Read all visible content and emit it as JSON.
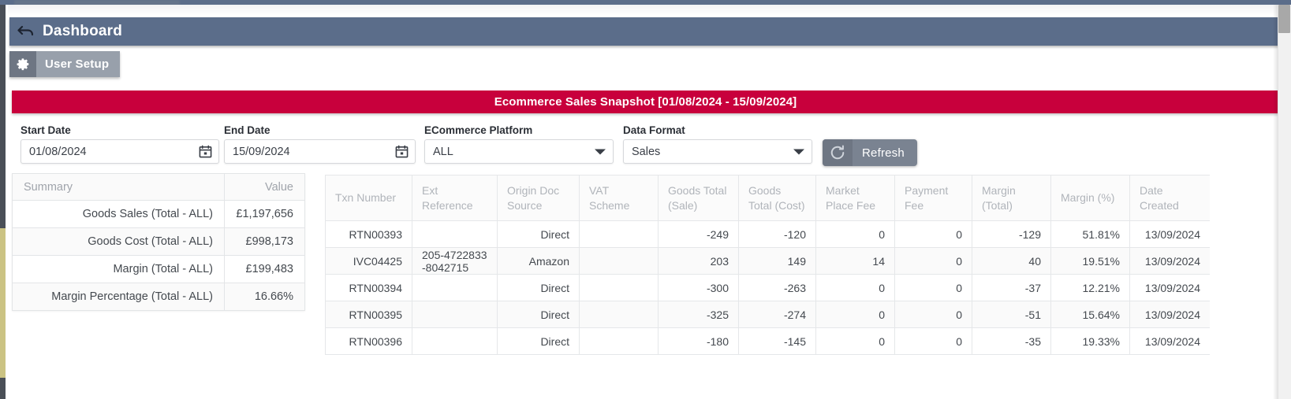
{
  "header": {
    "back_icon": "undo-arrow-icon",
    "title": "Dashboard"
  },
  "user_setup": {
    "icon": "gear-icon",
    "label": "User Setup"
  },
  "snapshot": {
    "title": "Ecommerce Sales Snapshot [01/08/2024 - 15/09/2024]"
  },
  "filters": {
    "start_date": {
      "label": "Start Date",
      "value": "01/08/2024",
      "icon": "calendar-icon"
    },
    "end_date": {
      "label": "End Date",
      "value": "15/09/2024",
      "icon": "calendar-icon"
    },
    "platform": {
      "label": "ECommerce Platform",
      "value": "ALL",
      "icon": "chevron-down-icon"
    },
    "data_format": {
      "label": "Data Format",
      "value": "Sales",
      "icon": "chevron-down-icon"
    },
    "refresh": {
      "label": "Refresh",
      "icon": "refresh-icon"
    }
  },
  "summary": {
    "headers": [
      "Summary",
      "Value"
    ],
    "rows": [
      {
        "key": "Goods Sales (Total - ALL)",
        "value": "£1,197,656"
      },
      {
        "key": "Goods Cost (Total - ALL)",
        "value": "£998,173"
      },
      {
        "key": "Margin (Total - ALL)",
        "value": "£199,483"
      },
      {
        "key": "Margin Percentage (Total - ALL)",
        "value": "16.66%"
      }
    ]
  },
  "grid": {
    "headers": [
      "Txn Number",
      "Ext Reference",
      "Origin Doc Source",
      "VAT Scheme",
      "Goods Total (Sale)",
      "Goods Total (Cost)",
      "Market Place Fee",
      "Payment Fee",
      "Margin (Total)",
      "Margin (%)",
      "Date Created"
    ],
    "rows": [
      {
        "txn": "RTN00393",
        "ext": "",
        "origin": "Direct",
        "vat": "",
        "goods_sale": "-249",
        "goods_cost": "-120",
        "mkt_fee": "0",
        "pay_fee": "0",
        "margin": "-129",
        "margin_pct": "51.81%",
        "date": "13/09/2024"
      },
      {
        "txn": "IVC04425",
        "ext": "205-4722833-8042715",
        "origin": "Amazon",
        "vat": "",
        "goods_sale": "203",
        "goods_cost": "149",
        "mkt_fee": "14",
        "pay_fee": "0",
        "margin": "40",
        "margin_pct": "19.51%",
        "date": "13/09/2024"
      },
      {
        "txn": "RTN00394",
        "ext": "",
        "origin": "Direct",
        "vat": "",
        "goods_sale": "-300",
        "goods_cost": "-263",
        "mkt_fee": "0",
        "pay_fee": "0",
        "margin": "-37",
        "margin_pct": "12.21%",
        "date": "13/09/2024"
      },
      {
        "txn": "RTN00395",
        "ext": "",
        "origin": "Direct",
        "vat": "",
        "goods_sale": "-325",
        "goods_cost": "-274",
        "mkt_fee": "0",
        "pay_fee": "0",
        "margin": "-51",
        "margin_pct": "15.64%",
        "date": "13/09/2024"
      },
      {
        "txn": "RTN00396",
        "ext": "",
        "origin": "Direct",
        "vat": "",
        "goods_sale": "-180",
        "goods_cost": "-145",
        "mkt_fee": "0",
        "pay_fee": "0",
        "margin": "-35",
        "margin_pct": "19.33%",
        "date": "13/09/2024"
      }
    ]
  },
  "colors": {
    "header_blue": "#5b6d8a",
    "banner_red": "#c8003c",
    "button_gray": "#7a8391",
    "rail_dark": "#4a4f57",
    "rail_khaki": "#cbc383"
  }
}
